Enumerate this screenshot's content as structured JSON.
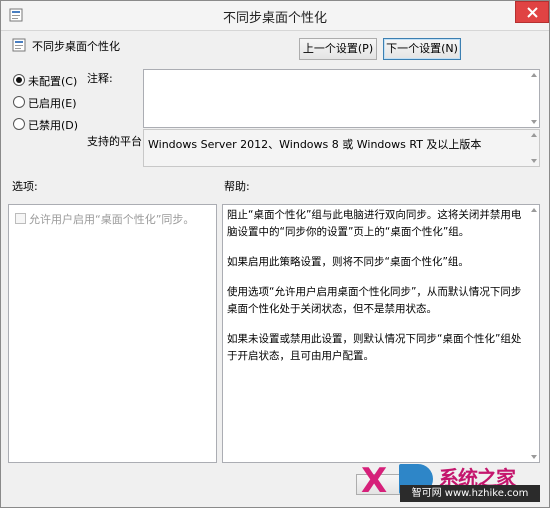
{
  "window": {
    "title": "不同步桌面个性化",
    "close_icon": "close-icon"
  },
  "policy": {
    "name": "不同步桌面个性化"
  },
  "nav": {
    "prev_label": "上一个设置(P)",
    "next_label": "下一个设置(N)"
  },
  "state": {
    "options": [
      {
        "label": "未配置(C)",
        "checked": true
      },
      {
        "label": "已启用(E)",
        "checked": false
      },
      {
        "label": "已禁用(D)",
        "checked": false
      }
    ]
  },
  "comment": {
    "label": "注释:",
    "value": ""
  },
  "platform": {
    "label": "支持的平台:",
    "value": "Windows Server 2012、Windows 8 或 Windows RT 及以上版本"
  },
  "options_pane": {
    "header": "选项:",
    "checkbox_label": "允许用户启用“桌面个性化”同步。",
    "checkbox_checked": false
  },
  "help_pane": {
    "header": "帮助:",
    "paragraphs": [
      "阻止“桌面个性化”组与此电脑进行双向同步。这将关闭并禁用电脑设置中的“同步你的设置”页上的“桌面个性化”组。",
      "如果启用此策略设置，则将不同步“桌面个性化”组。",
      "使用选项“允许用户启用桌面个性化同步”，从而默认情况下同步桌面个性化处于关闭状态，但不是禁用状态。",
      "如果未设置或禁用此设置，则默认情况下同步“桌面个性化”组处于开启状态，且可由用户配置。"
    ]
  },
  "watermark": {
    "brand": "系统之家",
    "url": "智可网 www.hzhike.com"
  }
}
